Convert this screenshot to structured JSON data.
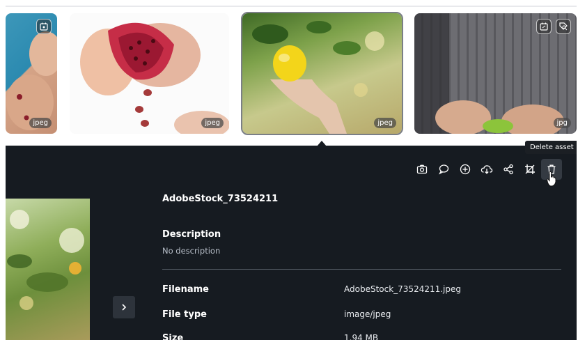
{
  "thumbnails": [
    {
      "ext": "jpeg",
      "icons": [
        "eye-calendar-icon"
      ]
    },
    {
      "ext": "jpeg",
      "icons": []
    },
    {
      "ext": "jpeg",
      "icons": [],
      "selected": true
    },
    {
      "ext": "jpg",
      "icons": [
        "calendar-edit-icon",
        "tag-search-icon"
      ]
    }
  ],
  "toolbar": {
    "tooltip": "Delete asset",
    "icons": [
      "camera-icon",
      "comment-icon",
      "add-circle-icon",
      "cloud-download-icon",
      "share-icon",
      "crop-icon",
      "trash-icon"
    ]
  },
  "details": {
    "asset_title": "AdobeStock_73524211",
    "description_label": "Description",
    "description_value": "No description",
    "fields": [
      {
        "label": "Filename",
        "value": "AdobeStock_73524211.jpeg"
      },
      {
        "label": "File type",
        "value": "image/jpeg"
      },
      {
        "label": "Size",
        "value": "1.94 MB"
      }
    ]
  }
}
